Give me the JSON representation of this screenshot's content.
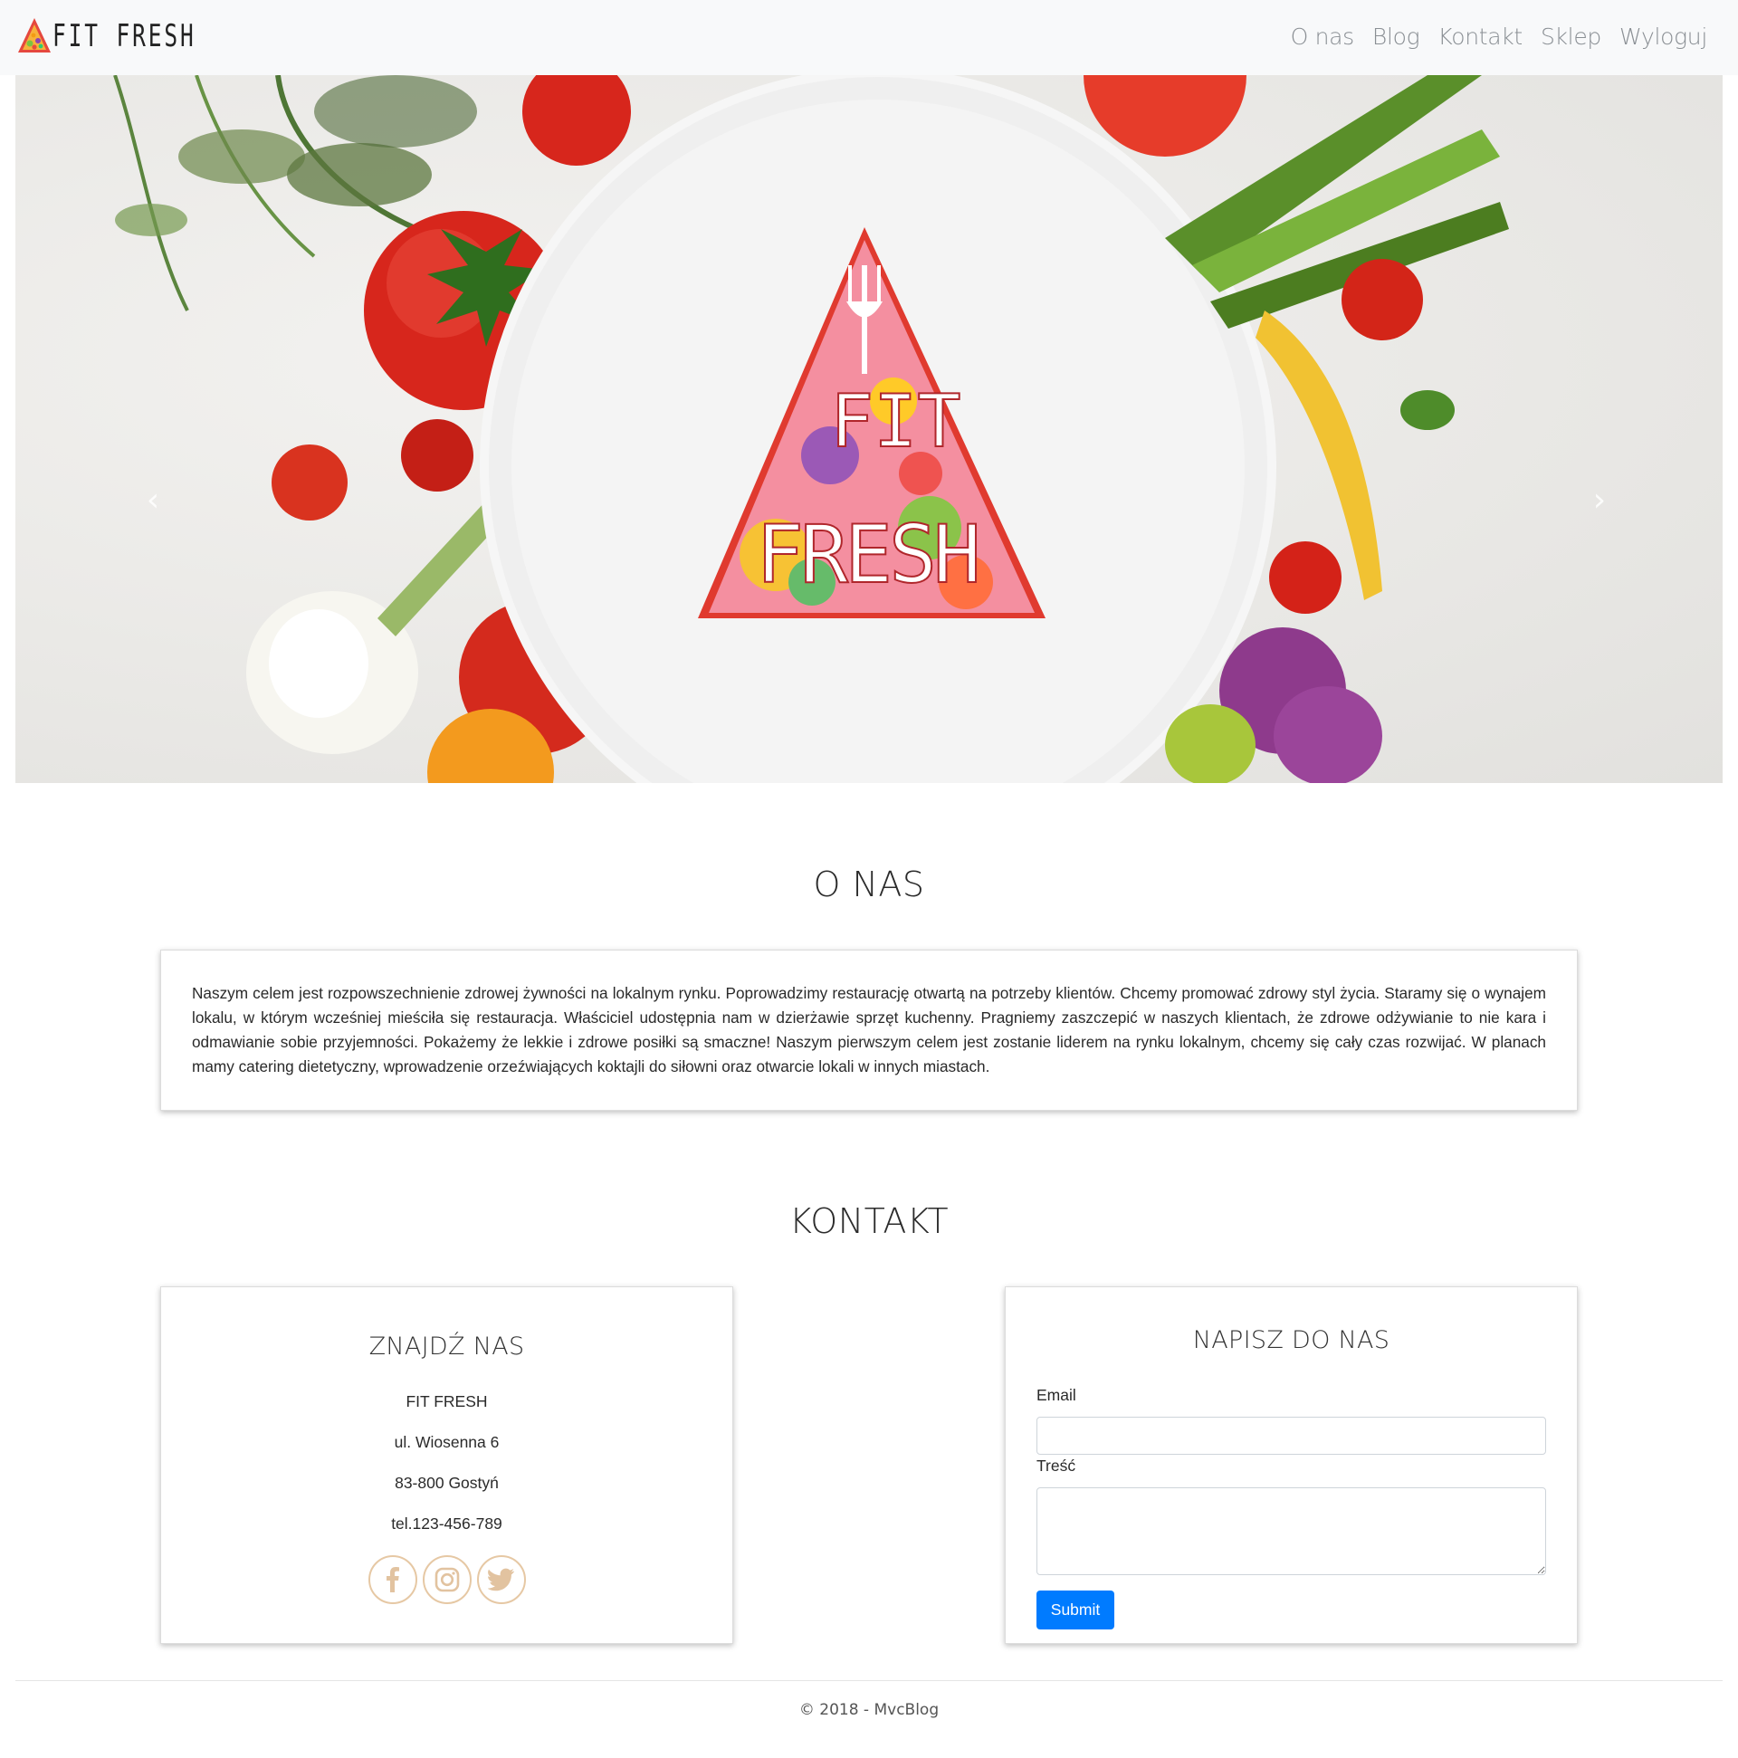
{
  "brand": {
    "name": "FIT FRESH",
    "logo_icon": "fit-fresh-triangle-logo-icon"
  },
  "nav": {
    "items": [
      {
        "label": "O nas"
      },
      {
        "label": "Blog"
      },
      {
        "label": "Kontakt"
      },
      {
        "label": "Sklep"
      },
      {
        "label": "Wyloguj"
      }
    ]
  },
  "hero": {
    "image": "vegetables-plate-hero-image",
    "logo_line1": "FIT",
    "logo_line2": "FRESH",
    "prev_icon": "chevron-left-icon",
    "next_icon": "chevron-right-icon"
  },
  "about": {
    "title": "O NAS",
    "text": "Naszym celem jest rozpowszechnienie zdrowej żywności na lokalnym rynku. Poprowadzimy restaurację otwartą na potrzeby klientów. Chcemy promować zdrowy styl życia. Staramy się o wynajem lokalu, w którym wcześniej mieściła się restauracja. Właściciel udostępnia nam w dzierżawie sprzęt kuchenny. Pragniemy zaszczepić w naszych klientach, że zdrowe odżywianie to nie kara i odmawianie sobie przyjemności. Pokażemy że lekkie i zdrowe posiłki są smaczne! Naszym pierwszym celem jest zostanie liderem na rynku lokalnym, chcemy się cały czas rozwijać. W planach mamy catering dietetyczny, wprowadzenie orzeźwiających koktajli do siłowni oraz otwarcie lokali w innych miastach."
  },
  "contact": {
    "title": "KONTAKT",
    "find": {
      "title": "ZNAJDŹ NAS",
      "name": "FIT FRESH",
      "street": "ul. Wiosenna 6",
      "city": "83-800 Gostyń",
      "phone": "tel.123-456-789",
      "socials": [
        "facebook-icon",
        "instagram-icon",
        "twitter-icon"
      ]
    },
    "form": {
      "title": "NAPISZ DO NAS",
      "email_label": "Email",
      "email_value": "",
      "content_label": "Treść",
      "content_value": "",
      "submit_label": "Submit"
    }
  },
  "footer": {
    "text": "© 2018 - MvcBlog"
  },
  "colors": {
    "navbar_bg": "#f8f9fa",
    "nav_link": "#8a8f94",
    "submit": "#007bff",
    "social_ring": "#e6c8a4"
  }
}
